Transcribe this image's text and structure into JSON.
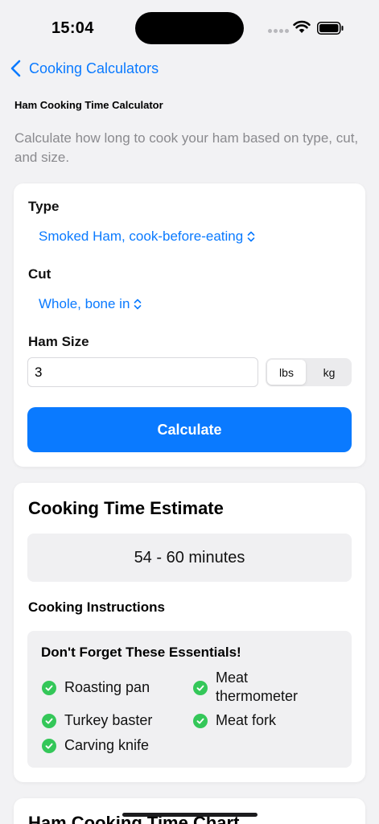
{
  "status": {
    "time": "15:04"
  },
  "nav": {
    "back_label": "Cooking Calculators"
  },
  "page": {
    "title": "Ham Cooking Time Calculator",
    "subtitle": "Calculate how long to cook your ham based on type, cut, and size."
  },
  "form": {
    "type_label": "Type",
    "type_value": "Smoked Ham, cook-before-eating",
    "cut_label": "Cut",
    "cut_value": "Whole, bone in",
    "size_label": "Ham Size",
    "size_value": "3",
    "units": [
      "lbs",
      "kg"
    ],
    "selected_unit": "lbs",
    "calculate_label": "Calculate"
  },
  "result": {
    "title": "Cooking Time Estimate",
    "estimate": "54 - 60 minutes",
    "instructions_heading": "Cooking Instructions",
    "essentials_title": "Don't Forget These Essentials!",
    "essentials": [
      "Roasting pan",
      "Meat thermometer",
      "Turkey baster",
      "Meat fork",
      "Carving knife"
    ]
  },
  "chart_section": {
    "title": "Ham Cooking Time Chart"
  },
  "colors": {
    "accent": "#0a7aff",
    "check": "#34c759",
    "background": "#f2f2f4"
  }
}
